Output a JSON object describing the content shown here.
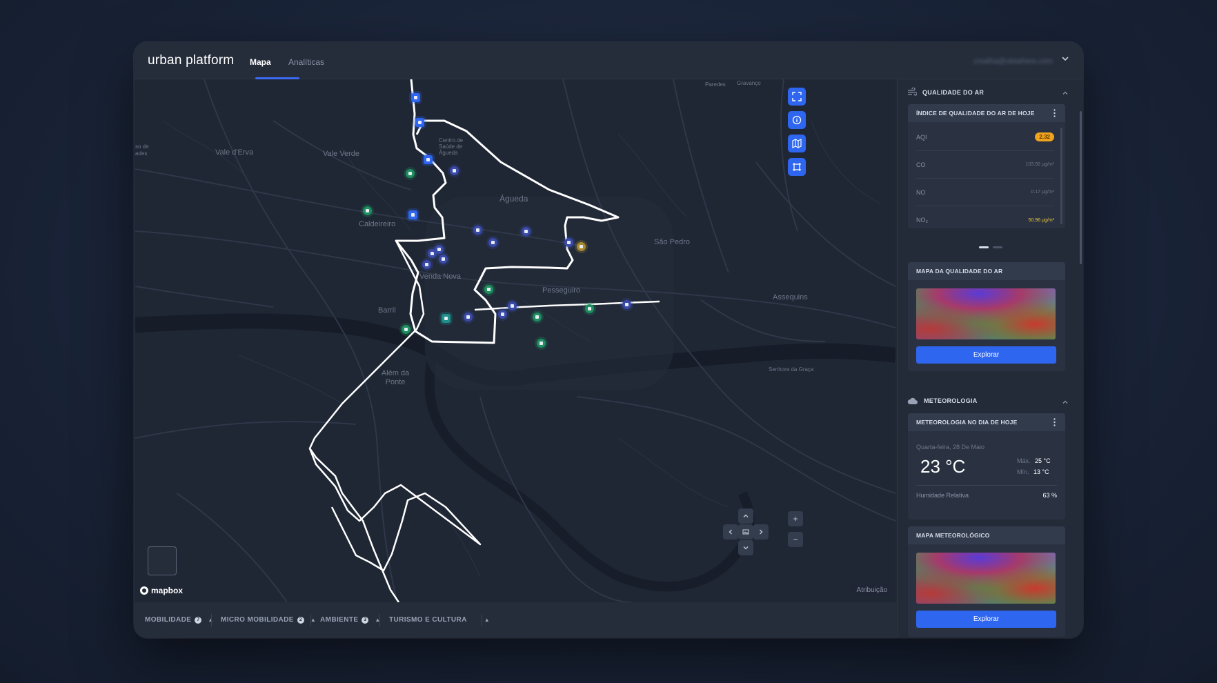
{
  "app": {
    "title": "urban platform",
    "user_email": "cmalha@ubiwhere.com"
  },
  "tabs": [
    {
      "label": "Mapa",
      "active": true
    },
    {
      "label": "Analíticas",
      "active": false
    }
  ],
  "map": {
    "places": [
      "Vale d'Erva",
      "Vale Verde",
      "Centro de Saúde de Águeda",
      "Águeda",
      "Caldeireiro",
      "Venda Nova",
      "Pesseguiro",
      "São Pedro",
      "Assequins",
      "Barril",
      "Além da Ponte",
      "Senhora da Graça",
      "Paredes",
      "Gravanço",
      "so de",
      "ades"
    ],
    "attribution": "Atribuição",
    "logo_text": "mapbox",
    "controls": [
      "fullscreen",
      "info",
      "map-layers",
      "select-area"
    ],
    "zoom_in": "+",
    "zoom_out": "−"
  },
  "bottom_layers": [
    {
      "label": "MOBILIDADE",
      "count": "7"
    },
    {
      "label": "MICRO MOBILIDADE",
      "count": "2"
    },
    {
      "label": "AMBIENTE",
      "count": "3"
    },
    {
      "label": "TURISMO E CULTURA",
      "count": ""
    }
  ],
  "air_quality": {
    "section_title": "QUALIDADE DO AR",
    "card_title": "ÍNDICE DE QUALIDADE DO AR DE HOJE",
    "rows": [
      {
        "label": "AQI",
        "value": "2.32"
      },
      {
        "label": "CO",
        "value": "103.92 μg/m³"
      },
      {
        "label": "NO",
        "value": "0.17 μg/m³"
      },
      {
        "label": "NO₂",
        "value": "50.96 μg/m³"
      }
    ],
    "map_card_title": "MAPA DA QUALIDADE DO AR",
    "explore_label": "Explorar"
  },
  "meteorology": {
    "section_title": "METEOROLOGIA",
    "card_title": "METEOROLOGIA NO DIA DE HOJE",
    "date": "Quarta-feira, 28 De Maio",
    "temperature": "23 °C",
    "max_label": "Máx.",
    "max_value": "25 °C",
    "min_label": "Mín.",
    "min_value": "13 °C",
    "humidity_label": "Humidade Relativa",
    "humidity_value": "63 %",
    "map_card_title": "MAPA METEOROLÓGICO",
    "explore_label": "Explorar"
  },
  "colors": {
    "accent": "#2e66f0",
    "aqi_badge": "#f0a31c",
    "no2_value": "#e8c642",
    "marker_green": "#1f8f5f",
    "marker_blue": "#3a55c8"
  }
}
